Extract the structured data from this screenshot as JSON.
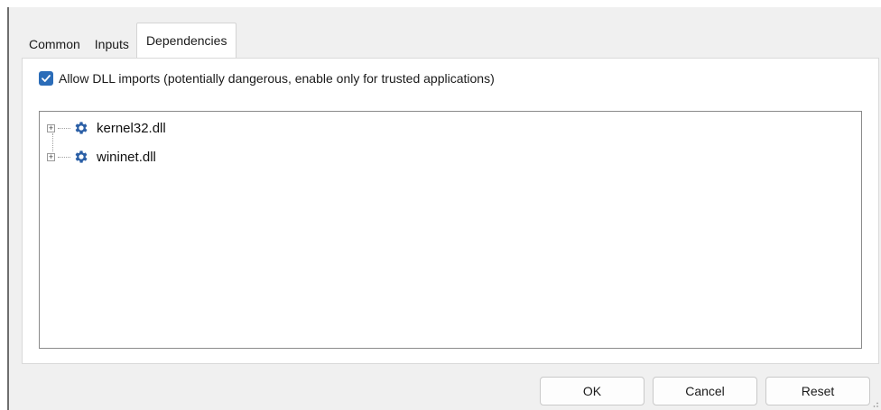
{
  "tabs": [
    {
      "label": "Common"
    },
    {
      "label": "Inputs"
    },
    {
      "label": "Dependencies"
    }
  ],
  "active_tab": "Dependencies",
  "allow_dll": {
    "checked": true,
    "label": "Allow DLL imports (potentially dangerous, enable only for trusted applications)"
  },
  "tree": {
    "items": [
      {
        "label": "kernel32.dll",
        "icon": "gear-icon",
        "expanded": false
      },
      {
        "label": "wininet.dll",
        "icon": "gear-icon",
        "expanded": false
      }
    ]
  },
  "buttons": {
    "ok": "OK",
    "cancel": "Cancel",
    "reset": "Reset"
  },
  "colors": {
    "accent": "#2b6cb8",
    "icon": "#2b5fa6"
  }
}
